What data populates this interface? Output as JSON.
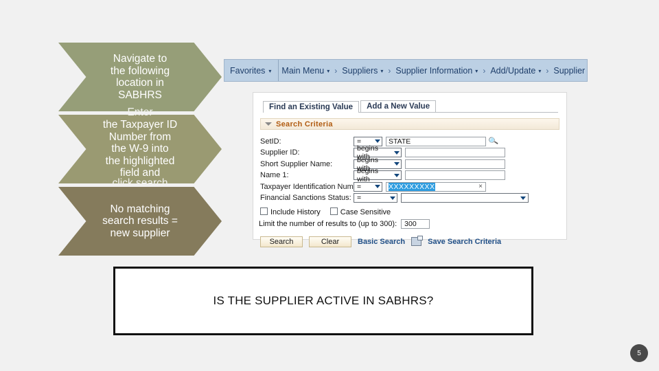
{
  "slide": {
    "background_color": "#f1f1f1",
    "page_number": "5"
  },
  "process_steps": [
    {
      "text": "Navigate to\nthe following\nlocation in\nSABHRS",
      "overflow_text": "",
      "color": "#969e78"
    },
    {
      "text": "the Taxpayer ID\nNumber from\nthe W-9 into\nthe highlighted\nfield and",
      "overflow_above": "Enter",
      "overflow_below": "click search",
      "color": "#9a9a72"
    },
    {
      "text": "No matching\nsearch results =\nnew supplier",
      "overflow_text": "",
      "color": "#857b5c"
    }
  ],
  "breadcrumb": {
    "favorites_label": "Favorites",
    "caret": "▾",
    "separator": "›",
    "items": [
      "Main Menu",
      "Suppliers",
      "Supplier Information",
      "Add/Update",
      "Supplier"
    ]
  },
  "search_page": {
    "tabs": [
      {
        "label": "Find an Existing Value",
        "active": true
      },
      {
        "label": "Add a New Value",
        "active": false
      }
    ],
    "section_title": "Search Criteria",
    "fields": [
      {
        "label": "SetID:",
        "operator": "=",
        "value": "STATE",
        "op_width": "narrow",
        "has_lookup": true,
        "highlighted": false
      },
      {
        "label": "Supplier ID:",
        "operator": "begins with",
        "value": "",
        "op_width": "wide",
        "has_lookup": false,
        "highlighted": false
      },
      {
        "label": "Short Supplier Name:",
        "operator": "begins with",
        "value": "",
        "op_width": "wide",
        "has_lookup": false,
        "highlighted": false
      },
      {
        "label": "Name 1:",
        "operator": "begins with",
        "value": "",
        "op_width": "wide",
        "has_lookup": false,
        "highlighted": false
      },
      {
        "label": "Taxpayer Identification Number:",
        "operator": "=",
        "value": "XXXXXXXXX",
        "op_width": "narrow",
        "has_lookup": false,
        "highlighted": true,
        "clear_glyph": "×"
      }
    ],
    "sanctions_field": {
      "label": "Financial Sanctions Status:",
      "operator": "=",
      "value": ""
    },
    "checkboxes": [
      {
        "label": "Include History",
        "checked": false
      },
      {
        "label": "Case Sensitive",
        "checked": false
      }
    ],
    "limit": {
      "label": "Limit the number of results to (up to 300):",
      "value": "300"
    },
    "buttons": [
      {
        "label": "Search"
      },
      {
        "label": "Clear"
      }
    ],
    "links": [
      {
        "label": "Basic Search"
      },
      {
        "label": "Save Search Criteria"
      }
    ],
    "lookup_icon": "magnifier-icon",
    "save_icon": "save-criteria-icon"
  },
  "question_box": {
    "text": "IS THE SUPPLIER ACTIVE IN SABHRS?"
  }
}
